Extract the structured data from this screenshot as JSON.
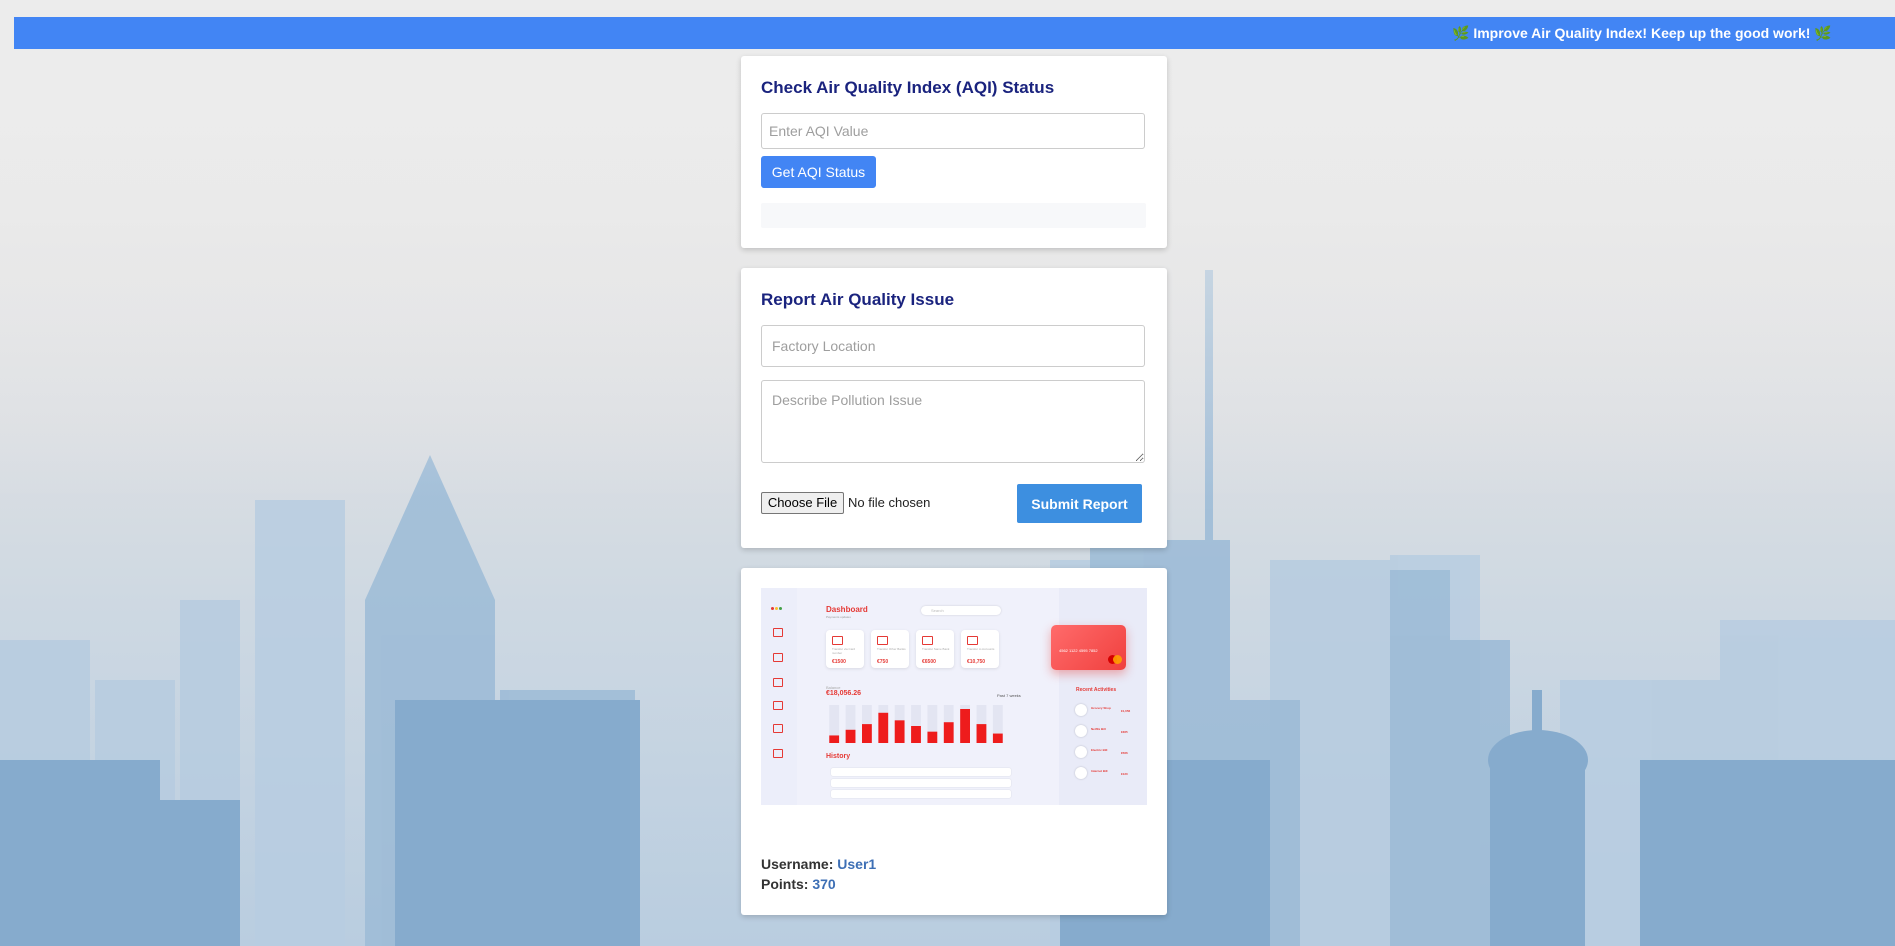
{
  "banner": {
    "message": "🌿 Improve Air Quality Index! Keep up the good work! 🌿"
  },
  "aqi": {
    "title": "Check Air Quality Index (AQI) Status",
    "input_placeholder": "Enter AQI Value",
    "input_value": "",
    "button_label": "Get AQI Status",
    "result_text": ""
  },
  "report": {
    "title": "Report Air Quality Issue",
    "location_placeholder": "Factory Location",
    "description_placeholder": "Describe Pollution Issue",
    "file_button_label": "Choose File",
    "file_status": "No file chosen",
    "submit_label": "Submit Report"
  },
  "dashboard_image": {
    "title": "Dashboard",
    "subtitle": "Payments updates",
    "search_placeholder": "Search",
    "tiles": [
      {
        "label": "Transfer via Card number",
        "value": "€1500"
      },
      {
        "label": "Transfer Other Banks",
        "value": "€750"
      },
      {
        "label": "Transfer Same Bank",
        "value": "€6500"
      },
      {
        "label": "Transfer to Accounts",
        "value": "€10,750"
      }
    ],
    "card_number": "4562 1122 4595 7852",
    "balance_label": "Balance",
    "balance": "€18,056.26",
    "filter_label": "Past 7 weeks",
    "history_label": "History",
    "bar_values": [
      4,
      7,
      10,
      16,
      12,
      9,
      6,
      11,
      18,
      10,
      5
    ],
    "recent_label": "Recent Activities",
    "activities": [
      {
        "name": "Grocery Shop",
        "amount": "€1,056"
      },
      {
        "name": "Netflix Bill",
        "amount": "€365"
      },
      {
        "name": "Electric Bill",
        "amount": "€566"
      },
      {
        "name": "Internet Bill",
        "amount": "€120"
      }
    ]
  },
  "user": {
    "username_label": "Username:",
    "username": "User1",
    "points_label": "Points:",
    "points": "370"
  },
  "colors": {
    "banner": "#4285f4",
    "title": "#1a237e",
    "button": "#4285f4",
    "submit": "#3d8fe0",
    "accent_value": "#3d6fb5"
  }
}
